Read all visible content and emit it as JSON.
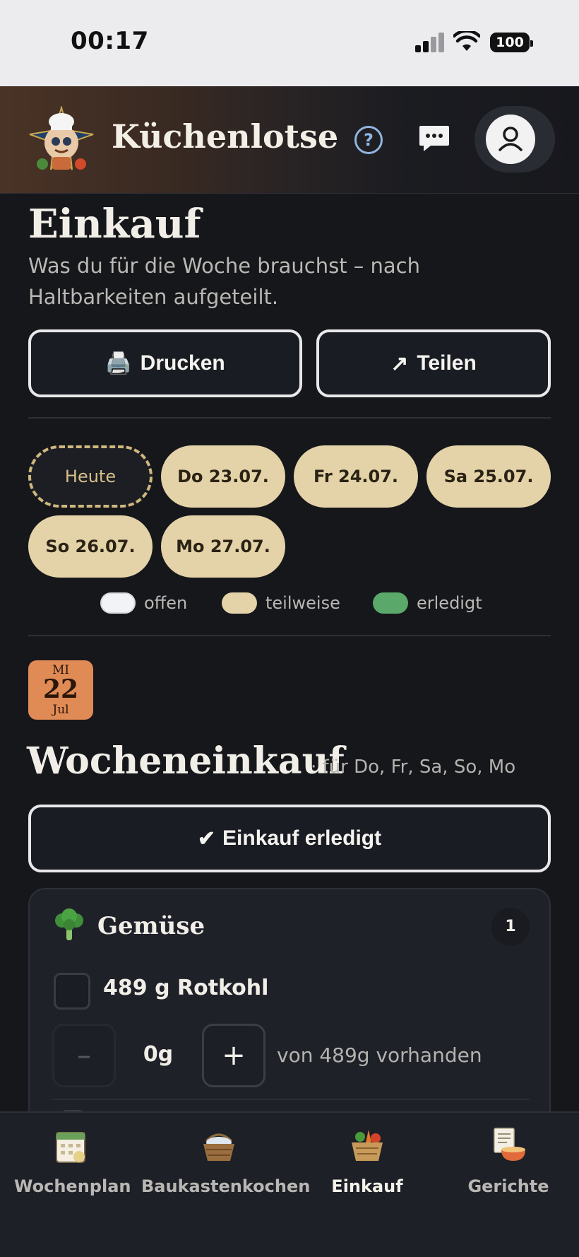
{
  "status_bar": {
    "time": "00:17",
    "battery": "100"
  },
  "header": {
    "app_name": "Küchenlotse",
    "help_glyph": "?",
    "help_icon": "question-icon",
    "chat_icon": "chat-icon",
    "profile_icon": "user-icon"
  },
  "main": {
    "title": "Einkauf",
    "subtitle": "Was du für die Woche brauchst – nach Haltbarkeiten aufgeteilt.",
    "print_icon": "🖨️",
    "print_label": "Drucken",
    "share_icon": "↗",
    "share_label": "Teilen",
    "days": [
      "Heute",
      "Do 23.07.",
      "Fr 24.07.",
      "Sa 25.07.",
      "So 26.07.",
      "Mo 27.07."
    ],
    "legend": [
      {
        "label": "offen",
        "color": "#f1f3f6"
      },
      {
        "label": "teilweise",
        "color": "#e4d3a8"
      },
      {
        "label": "erledigt",
        "color": "#5aa86a"
      }
    ]
  },
  "section": {
    "date_weekday": "MI",
    "date_day": "22",
    "date_month": "Jul",
    "title": "Wocheneinkauf",
    "subtitle": "· für Do, Fr, Sa, So, Mo",
    "done_icon": "✔",
    "done_label": "Einkauf erledigt",
    "category": {
      "icon": "🥦",
      "name": "Gemüse",
      "count": "1",
      "item_label": "489 g Rotkohl",
      "minus": "–",
      "plus": "+",
      "current_value": "0g",
      "available_note": "von 489g vorhanden"
    }
  },
  "bottom_nav": [
    {
      "label": "Wochenplan",
      "icon": "calendar-icon",
      "active": false
    },
    {
      "label": "Baukastenkochen",
      "icon": "basket-icon",
      "active": false
    },
    {
      "label": "Einkauf",
      "icon": "vegetable-basket-icon",
      "active": true
    },
    {
      "label": "Gerichte",
      "icon": "recipe-bowl-icon",
      "active": false
    }
  ],
  "colors": {
    "accent_sand": "#e4d3a8",
    "date_badge": "#e08a55",
    "background": "#16171b"
  }
}
